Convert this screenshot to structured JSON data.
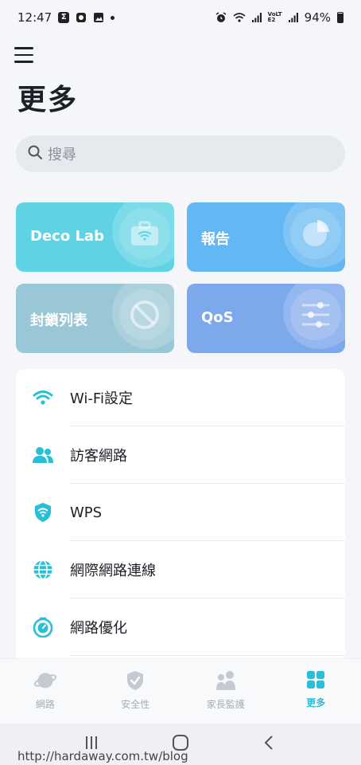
{
  "status_bar": {
    "time": "12:47",
    "battery": "94%",
    "network_label": "VoLTE2"
  },
  "header": {
    "title": "更多"
  },
  "search": {
    "placeholder": "搜尋"
  },
  "cards": [
    {
      "label": "Deco Lab",
      "color": "#5fd3e3",
      "icon": "briefcase-icon"
    },
    {
      "label": "報告",
      "color": "#63b7f2",
      "icon": "pie-chart-icon"
    },
    {
      "label": "封鎖列表",
      "color": "#9ac7d6",
      "icon": "block-icon"
    },
    {
      "label": "QoS",
      "color": "#7ea8ec",
      "icon": "sliders-icon"
    }
  ],
  "list_items": [
    {
      "label": "Wi-Fi設定",
      "icon": "wifi-icon"
    },
    {
      "label": "訪客網路",
      "icon": "guests-icon"
    },
    {
      "label": "WPS",
      "icon": "wps-shield-icon"
    },
    {
      "label": "網際網路連線",
      "icon": "globe-icon"
    },
    {
      "label": "網路優化",
      "icon": "optimize-icon"
    }
  ],
  "bottom_nav": [
    {
      "label": "網路",
      "icon": "planet-icon",
      "active": false
    },
    {
      "label": "安全性",
      "icon": "shield-check-icon",
      "active": false
    },
    {
      "label": "家長監護",
      "icon": "family-icon",
      "active": false
    },
    {
      "label": "更多",
      "icon": "grid-icon",
      "active": true
    }
  ],
  "accent_color": "#29bfd6",
  "watermark": "http://hardaway.com.tw/blog"
}
